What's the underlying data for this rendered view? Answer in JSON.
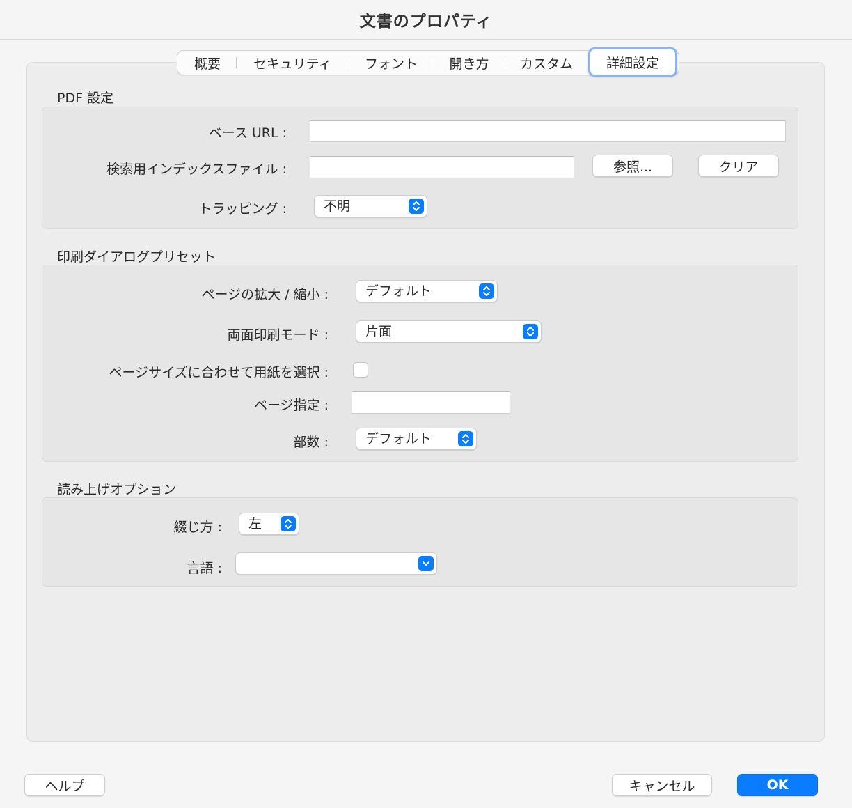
{
  "window": {
    "title": "文書のプロパティ"
  },
  "tabs": [
    {
      "label": "概要"
    },
    {
      "label": "セキュリティ"
    },
    {
      "label": "フォント"
    },
    {
      "label": "開き方"
    },
    {
      "label": "カスタム"
    },
    {
      "label": "詳細設定",
      "active": true
    }
  ],
  "pdf_settings": {
    "title": "PDF 設定",
    "base_url_label": "ベース URL :",
    "base_url_value": "",
    "index_file_label": "検索用インデックスファイル :",
    "index_file_value": "",
    "browse_button": "参照...",
    "clear_button": "クリア",
    "trapping_label": "トラッピング :",
    "trapping_value": "不明"
  },
  "print_presets": {
    "title": "印刷ダイアログプリセット",
    "scaling_label": "ページの拡大 / 縮小 :",
    "scaling_value": "デフォルト",
    "duplex_label": "両面印刷モード :",
    "duplex_value": "片面",
    "paper_by_size_label": "ページサイズに合わせて用紙を選択 :",
    "paper_by_size_checked": false,
    "page_range_label": "ページ指定 :",
    "page_range_value": "",
    "copies_label": "部数 :",
    "copies_value": "デフォルト"
  },
  "read_out": {
    "title": "読み上げオプション",
    "binding_label": "綴じ方 :",
    "binding_value": "左",
    "language_label": "言語 :",
    "language_value": ""
  },
  "footer": {
    "help_button": "ヘルプ",
    "cancel_button": "キャンセル",
    "ok_button": "OK"
  },
  "colors": {
    "accent": "#0a7cff",
    "focus_ring": "#8ab3f5"
  },
  "icons": {
    "stepper": "chevron-up-down-icon",
    "dropdown": "chevron-down-icon"
  }
}
